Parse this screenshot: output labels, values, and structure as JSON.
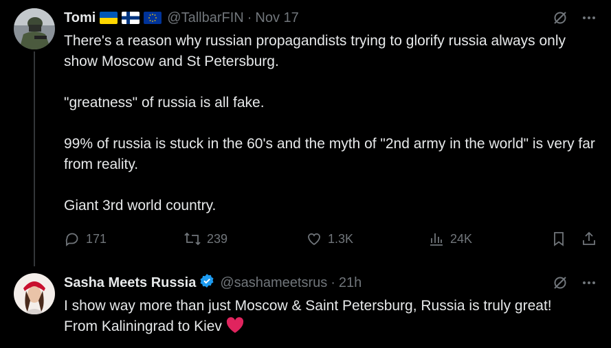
{
  "tweets": [
    {
      "author": "Tomi",
      "handle": "@TallbarFIN",
      "time": "Nov 17",
      "text": [
        "There's a reason why russian propagandists trying to glorify russia always only show Moscow and St Petersburg.",
        "\"greatness\" of russia is all fake.",
        "99% of russia is stuck in the 60's and the myth of \"2nd army in the world\" is very far from reality.",
        "Giant 3rd world country."
      ],
      "stats": {
        "replies": "171",
        "reposts": "239",
        "likes": "1.3K",
        "views": "24K"
      }
    },
    {
      "author": "Sasha Meets Russia",
      "handle": "@sashameetsrus",
      "time": "21h",
      "text_line1": "I show way more than just Moscow & Saint Petersburg, Russia is truly great!",
      "text_line2": "From Kaliningrad to Kiev"
    }
  ],
  "separator": "·",
  "icons": {
    "more": "more-icon",
    "grok": "grok-icon",
    "reply": "reply-icon",
    "repost": "repost-icon",
    "like": "like-icon",
    "views": "views-icon",
    "bookmark": "bookmark-icon",
    "share": "share-icon",
    "heart_emoji": "red-heart-emoji",
    "verified": "verified-badge-icon",
    "flags": [
      "ukraine-flag",
      "finland-flag",
      "eu-flag"
    ]
  },
  "colors": {
    "background": "#000000",
    "text": "#e7e9ea",
    "muted": "#71767b",
    "verified": "#1d9bf0",
    "heart": "#f91880"
  }
}
